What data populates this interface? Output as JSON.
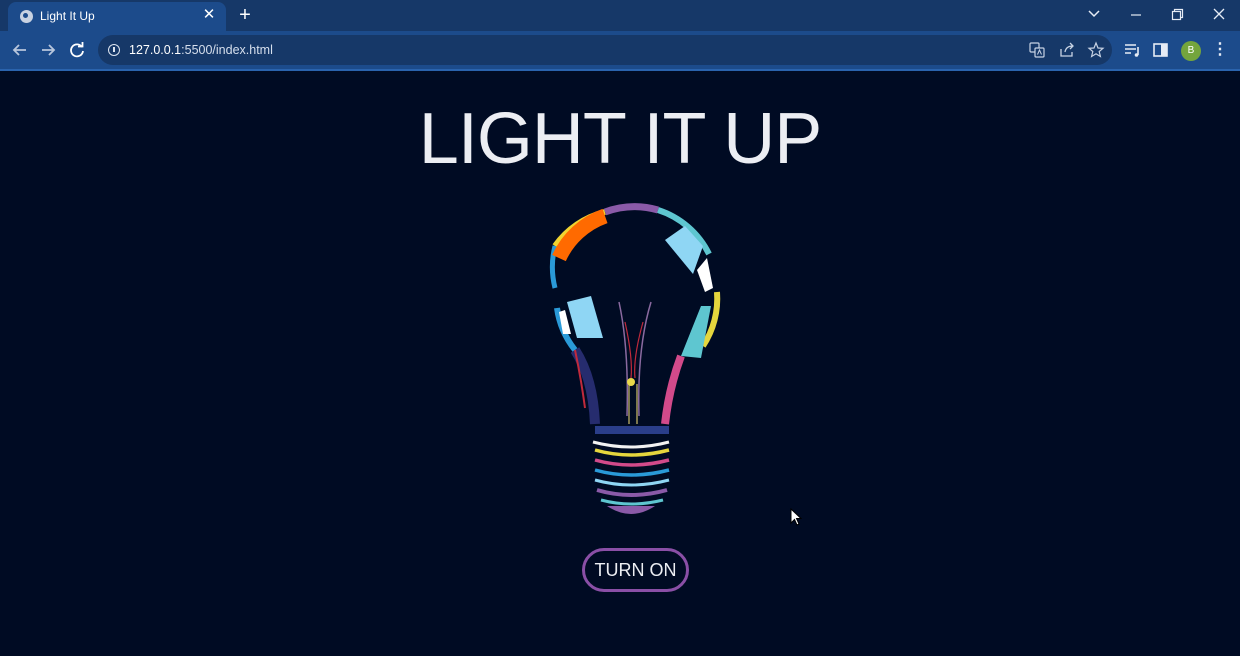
{
  "browser": {
    "tab_title": "Light It Up",
    "tab_close_icon": "close-icon",
    "new_tab_icon": "plus-icon",
    "url_host": "127.0.0.1",
    "url_rest": ":5500/index.html",
    "profile_initial": "B",
    "accent": "#1c4b8b",
    "titlebar_color": "#163868"
  },
  "page": {
    "heading": "LIGHT IT UP",
    "button_label": "TURN ON",
    "background": "#000b23",
    "button_border": "#8a4fa6",
    "bulb_state": "off",
    "bulb_icon": "lightbulb-icon"
  }
}
